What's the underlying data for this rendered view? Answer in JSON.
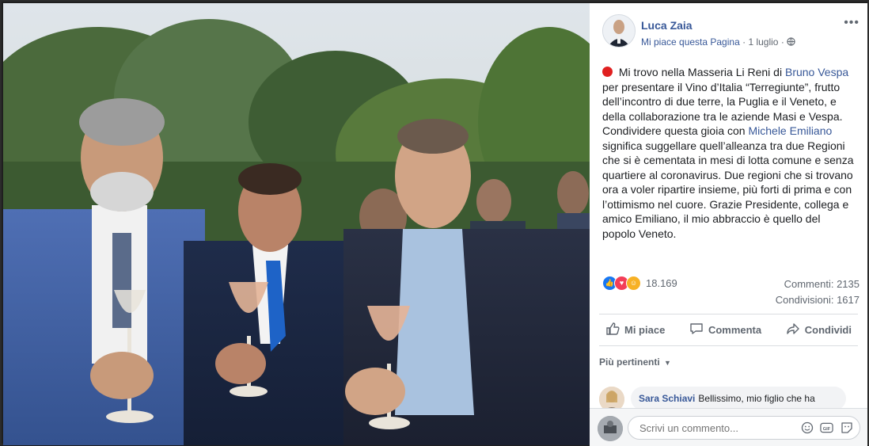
{
  "author": {
    "name": "Luca Zaia",
    "like_page": "Mi piace questa Pagina",
    "date": "1 luglio"
  },
  "post": {
    "segments": [
      " Mi trovo nella Masseria Li Reni di ",
      "Bruno Vespa",
      " per presentare il Vino d’Italia “Terregiunte”, frutto dell’incontro di due terre, la Puglia e il Veneto, e della collaborazione tra le aziende Masi e Vespa. Condividere questa gioia con ",
      "Michele Emiliano",
      " significa suggellare quell’alleanza tra due Regioni che si è cementata in mesi di lotta comune e senza quartiere al coronavirus. Due regioni che si trovano ora a voler ripartire insieme, più forti di prima e con l’ottimismo nel cuore. Grazie Presidente, collega e amico Emiliano, il mio abbraccio è quello del popolo Veneto."
    ]
  },
  "reactions": {
    "count": "18.169",
    "icons": [
      "like-icon",
      "love-icon",
      "care-icon"
    ]
  },
  "stats": {
    "comments": "Commenti: 2135",
    "shares": "Condivisioni: 1617"
  },
  "actions": {
    "like": "Mi piace",
    "comment": "Commenta",
    "share": "Condividi"
  },
  "comments": {
    "filter": "Più pertinenti",
    "first": {
      "name": "Sara Schiavi",
      "text": "Bellissimo, mio figlio che ha"
    }
  },
  "composer": {
    "placeholder": "Scrivi un commento...",
    "icons": [
      "emoji-icon",
      "gif-icon",
      "sticker-icon"
    ]
  },
  "colors": {
    "link": "#385898",
    "text": "#1c1e21",
    "secondary": "#606770",
    "like": "#1877f2",
    "love": "#f33e58"
  }
}
